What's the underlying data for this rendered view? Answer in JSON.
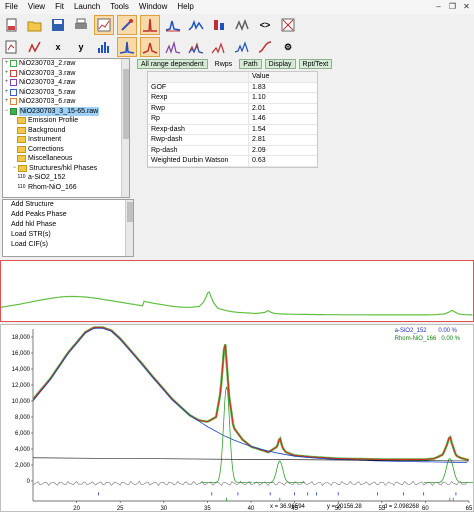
{
  "menu": [
    "File",
    "View",
    "Fit",
    "Launch",
    "Tools",
    "Window",
    "Help"
  ],
  "toolbar_icons": [
    "new-icon",
    "open-icon",
    "save-icon",
    "print-icon",
    "fit-icon",
    "run-icon",
    "peaks-icon",
    "profile-icon",
    "refine-icon",
    "phase-icon",
    "export-icon",
    "code-icon",
    "select-icon"
  ],
  "toolbar2_labels": {
    "x": "x",
    "y": "y"
  },
  "tree": {
    "files": [
      "NiO230703_2.raw",
      "NiO230703_3.raw",
      "NiO230703_4.raw",
      "NiO230703_5.raw",
      "NiO230703_6.raw",
      "NiO230703_3_15-65.raw"
    ],
    "children": [
      "Emission Profile",
      "Background",
      "Instrument",
      "Corrections",
      "Miscellaneous",
      "Structures/hkl Phases"
    ],
    "phases": [
      "a-SiO2_152",
      "Rhom-NiO_166"
    ],
    "hkl_label": "110"
  },
  "actions": [
    "Add Structure",
    "Add Peaks Phase",
    "Add hkl Phase",
    "Load STR(s)",
    "Load CIF(s)"
  ],
  "tabs": [
    "All range dependent",
    "Rwps",
    "Path",
    "Display",
    "Rpt/Text"
  ],
  "table": {
    "header": "Value",
    "rows": [
      {
        "name": "GOF",
        "value": "1.83"
      },
      {
        "name": "Rexp",
        "value": "1.10"
      },
      {
        "name": "Rwp",
        "value": "2.01"
      },
      {
        "name": "Rp",
        "value": "1.46"
      },
      {
        "name": "Rexp-dash",
        "value": "1.54"
      },
      {
        "name": "Rwp-dash",
        "value": "2.81"
      },
      {
        "name": "Rp-dash",
        "value": "2.09"
      },
      {
        "name": "Weighted Durbin Watson",
        "value": "0.63"
      }
    ]
  },
  "legend": [
    {
      "name": "a-SiO2_152",
      "value": "0.00 %"
    },
    {
      "name": "Rhom-NiO_166",
      "value": "0.00 %"
    }
  ],
  "status": {
    "x": "x = 36.96594",
    "y": "y = 20156.28",
    "d": "d = 2.098268"
  },
  "chart_data": {
    "type": "line",
    "y_ticks": [
      "18,000",
      "16,000",
      "14,000",
      "12,000",
      "10,000",
      "8,000",
      "6,000",
      "4,000",
      "2,000",
      "0"
    ],
    "x_ticks": [
      "20",
      "25",
      "30",
      "35",
      "40",
      "45",
      "50",
      "55",
      "60",
      "65"
    ],
    "xlim": [
      15,
      65
    ],
    "ylim": [
      -2500,
      19000
    ],
    "observed_x": [
      15,
      17,
      19,
      21,
      22,
      23,
      24,
      25,
      27,
      29,
      31,
      33,
      34,
      35,
      36,
      36.5,
      37,
      37.5,
      38,
      39,
      40,
      42,
      43,
      43.3,
      43.6,
      44,
      45,
      47,
      50,
      55,
      60,
      61,
      62,
      62.5,
      62.8,
      63,
      63.5,
      64,
      65
    ],
    "observed_y": [
      10200,
      12800,
      16000,
      18600,
      19200,
      19200,
      18800,
      17800,
      15300,
      12700,
      10200,
      8200,
      7600,
      7400,
      8000,
      11000,
      17800,
      10500,
      6700,
      5200,
      4300,
      3600,
      4300,
      5500,
      4200,
      3600,
      3200,
      3000,
      2800,
      2700,
      2700,
      2800,
      3300,
      4600,
      5700,
      4800,
      3200,
      2900,
      2600
    ],
    "background_x": [
      15,
      17,
      19,
      21,
      22,
      23,
      24,
      25,
      27,
      29,
      31,
      33,
      35,
      37,
      39,
      41,
      43,
      45,
      47,
      50,
      55,
      60,
      65
    ],
    "background_y": [
      10000,
      12700,
      15900,
      18500,
      19100,
      19100,
      18700,
      17700,
      15200,
      12600,
      10100,
      8200,
      6800,
      5600,
      4700,
      4000,
      3500,
      3100,
      2900,
      2700,
      2500,
      2400,
      2300
    ]
  }
}
